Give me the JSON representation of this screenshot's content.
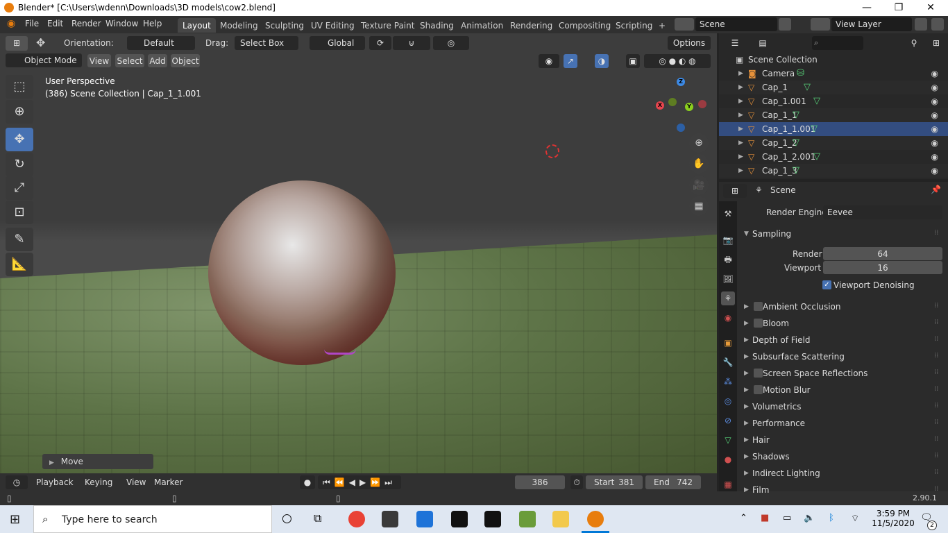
{
  "titlebar": {
    "title": "Blender* [C:\\Users\\wdenn\\Downloads\\3D models\\cow2.blend]",
    "minimize": "—",
    "maximize": "❐",
    "close": "✕"
  },
  "menu": {
    "items": [
      "File",
      "Edit",
      "Render",
      "Window",
      "Help"
    ]
  },
  "workspaces": {
    "tabs": [
      "Layout",
      "Modeling",
      "Sculpting",
      "UV Editing",
      "Texture Paint",
      "Shading",
      "Animation",
      "Rendering",
      "Compositing",
      "Scripting"
    ],
    "active": "Layout",
    "add": "+"
  },
  "scene_selector": {
    "value": "Scene"
  },
  "view_layer": {
    "value": "View Layer"
  },
  "tool_header": {
    "orientation_label": "Orientation:",
    "orientation_value": "Default",
    "drag_label": "Drag:",
    "drag_value": "Select Box",
    "transform_space": "Global",
    "options": "Options"
  },
  "viewport_header": {
    "mode": "Object Mode",
    "view": "View",
    "select": "Select",
    "add": "Add",
    "object": "Object"
  },
  "viewport": {
    "perspective": "User Perspective",
    "info": "(386) Scene Collection | Cap_1_1.001",
    "operator_panel": "Move"
  },
  "gizmo": {
    "z": "Z",
    "x": "X",
    "y": "Y",
    "x_color": "#e7454e",
    "y_color": "#8bcf1e",
    "z_color": "#3c8ae6"
  },
  "timeline": {
    "playback": "Playback",
    "keying": "Keying",
    "view": "View",
    "marker": "Marker",
    "current_frame": "386",
    "start_label": "Start",
    "start": "381",
    "end_label": "End",
    "end": "742"
  },
  "statusbar": {
    "version": "2.90.1"
  },
  "outliner": {
    "search_placeholder": "",
    "collection": "Scene Collection",
    "items": [
      {
        "name": "Camera",
        "kind": "camera"
      },
      {
        "name": "Cap_1",
        "kind": "mesh"
      },
      {
        "name": "Cap_1.001",
        "kind": "mesh"
      },
      {
        "name": "Cap_1_1",
        "kind": "mesh"
      },
      {
        "name": "Cap_1_1.001",
        "kind": "mesh"
      },
      {
        "name": "Cap_1_2",
        "kind": "mesh"
      },
      {
        "name": "Cap_1_2.001",
        "kind": "mesh"
      },
      {
        "name": "Cap_1_3",
        "kind": "mesh"
      }
    ]
  },
  "properties": {
    "context": "Scene",
    "render_engine_label": "Render Engine",
    "render_engine": "Eevee",
    "sampling": {
      "title": "Sampling",
      "render_label": "Render",
      "render": "64",
      "viewport_label": "Viewport",
      "viewport": "16",
      "denoise_label": "Viewport Denoising",
      "denoise_checked": true
    },
    "sections": [
      {
        "label": "Ambient Occlusion",
        "checkbox": true
      },
      {
        "label": "Bloom",
        "checkbox": true
      },
      {
        "label": "Depth of Field",
        "checkbox": false
      },
      {
        "label": "Subsurface Scattering",
        "checkbox": false
      },
      {
        "label": "Screen Space Reflections",
        "checkbox": true
      },
      {
        "label": "Motion Blur",
        "checkbox": true
      },
      {
        "label": "Volumetrics",
        "checkbox": false
      },
      {
        "label": "Performance",
        "checkbox": false
      },
      {
        "label": "Hair",
        "checkbox": false
      },
      {
        "label": "Shadows",
        "checkbox": false
      },
      {
        "label": "Indirect Lighting",
        "checkbox": false
      },
      {
        "label": "Film",
        "checkbox": false
      }
    ]
  },
  "taskbar": {
    "search_placeholder": "Type here to search",
    "time": "3:59 PM",
    "date": "11/5/2020",
    "notifications": "2"
  }
}
